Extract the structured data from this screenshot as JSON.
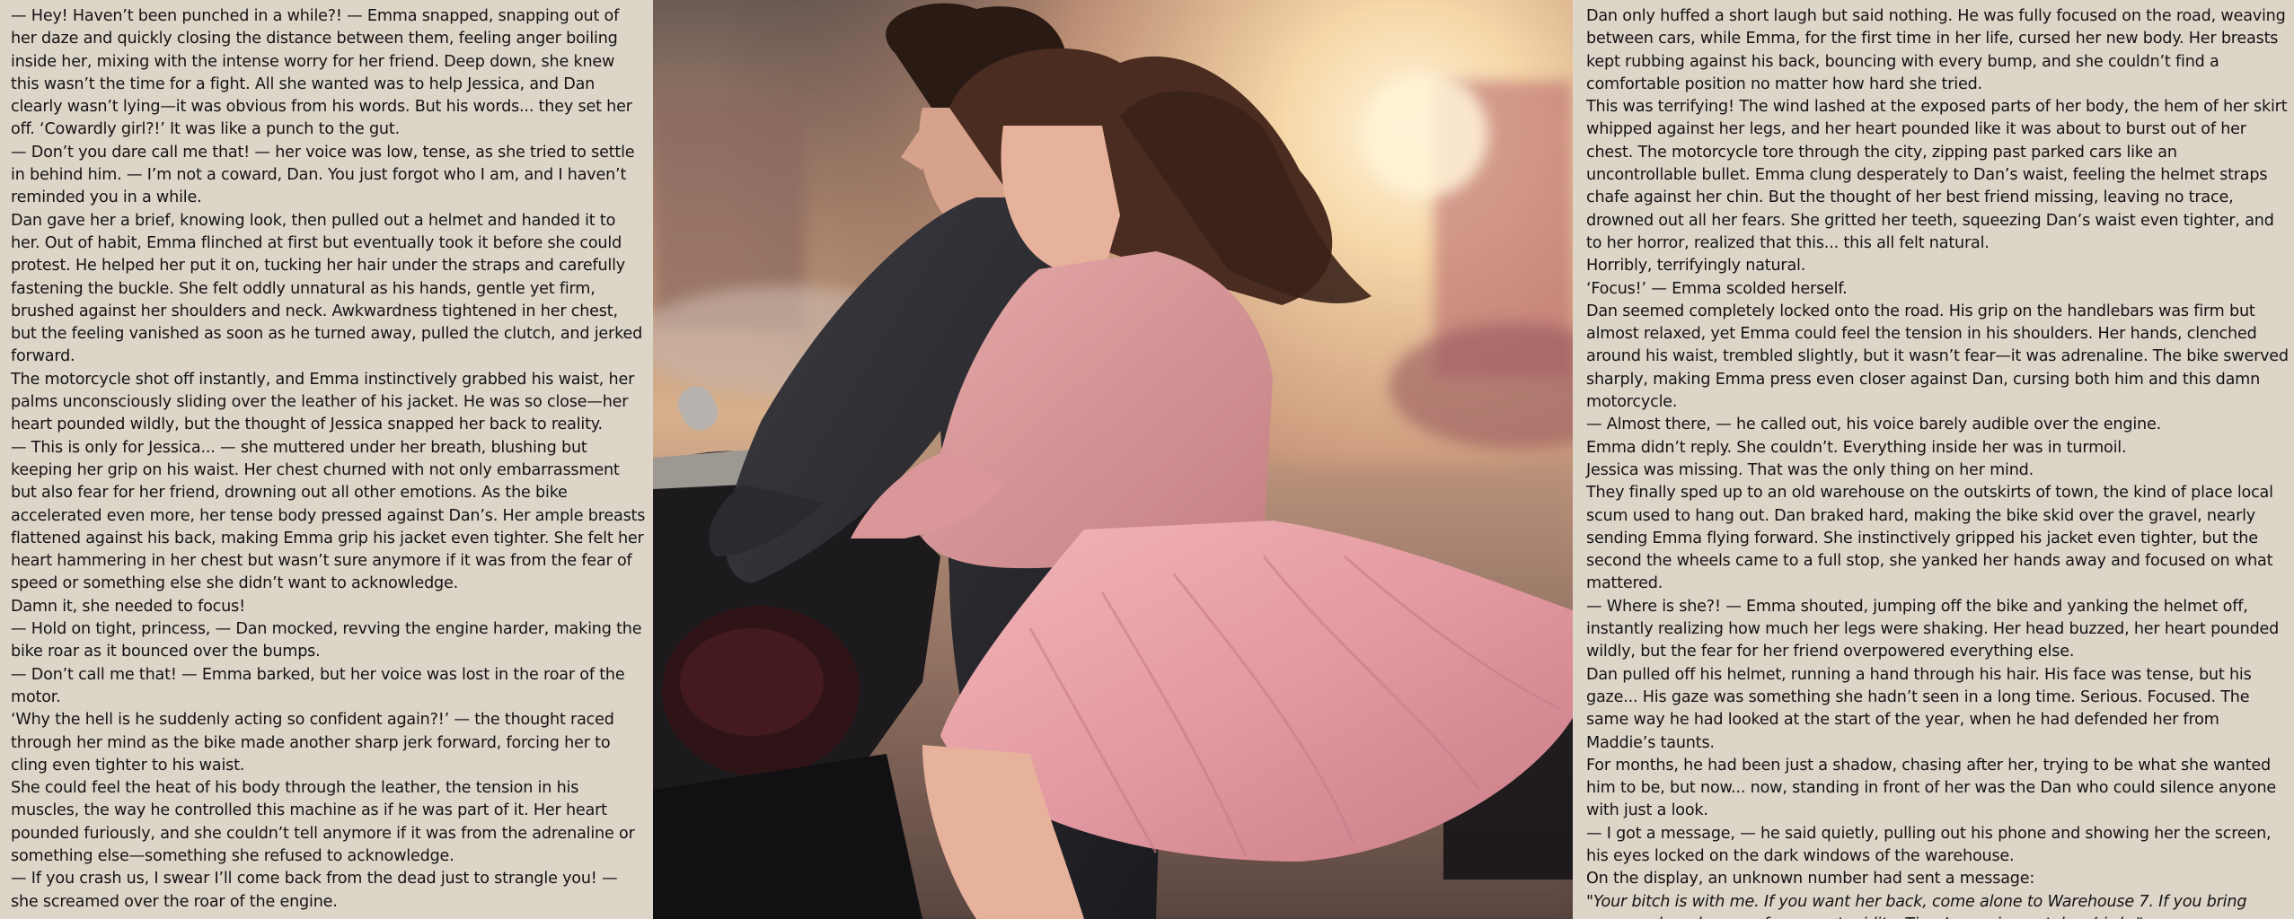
{
  "left_column": {
    "paragraphs": [
      "— Hey! Haven’t been punched in a while?! — Emma snapped, snapping out of her daze and quickly closing the distance between them, feeling anger boiling inside her, mixing with the intense worry for her friend. Deep down, she knew this wasn’t the time for a fight. All she wanted was to help Jessica, and Dan clearly wasn’t lying—it was obvious from his words. But his words... they set her off. ‘Cowardly girl?!’ It was like a punch to the gut.",
      "— Don’t you dare call me that! — her voice was low, tense, as she tried to settle in behind him. — I’m not a coward, Dan. You just forgot who I am, and I haven’t reminded you in a while.",
      "Dan gave her a brief, knowing look, then pulled out a helmet and handed it to her. Out of habit, Emma flinched at first but eventually took it before she could protest. He helped her put it on, tucking her hair under the straps and carefully fastening the buckle. She felt oddly unnatural as his hands, gentle yet firm, brushed against her shoulders and neck. Awkwardness tightened in her chest, but the feeling vanished as soon as he turned away, pulled the clutch, and jerked forward.",
      "The motorcycle shot off instantly, and Emma instinctively grabbed his waist, her palms unconsciously sliding over the leather of his jacket. He was so close—her heart pounded wildly, but the thought of Jessica snapped her back to reality.",
      "— This is only for Jessica... — she muttered under her breath, blushing but keeping her grip on his waist. Her chest churned with not only embarrassment but also fear for her friend, drowning out all other emotions. As the bike accelerated even more, her tense body pressed against Dan’s. Her ample breasts flattened against his back, making Emma grip his jacket even tighter. She felt her heart hammering in her chest but wasn’t sure anymore if it was from the fear of speed or something else she didn’t want to acknowledge.",
      "Damn it, she needed to focus!",
      "— Hold on tight, princess, — Dan mocked, revving the engine harder, making the bike roar as it bounced over the bumps.",
      "— Don’t call me that! — Emma barked, but her voice was lost in the roar of the motor.",
      "‘Why the hell is he suddenly acting so confident again?!’ — the thought raced through her mind as the bike made another sharp jerk forward, forcing her to cling even tighter to his waist.",
      "She could feel the heat of his body through the leather, the tension in his muscles, the way he controlled this machine as if he was part of it. Her heart pounded furiously, and she couldn’t tell anymore if it was from the adrenaline or something else—something she refused to acknowledge.",
      "— If you crash us, I swear I’ll come back from the dead just to strangle you! — she screamed over the roar of the engine."
    ]
  },
  "right_column": {
    "paragraphs": [
      "Dan only huffed a short laugh but said nothing. He was fully focused on the road, weaving between cars, while Emma, for the first time in her life, cursed her new body. Her breasts kept rubbing against his back, bouncing with every bump, and she couldn’t find a comfortable position no matter how hard she tried.",
      "This was terrifying! The wind lashed at the exposed parts of her body, the hem of her skirt whipped against her legs, and her heart pounded like it was about to burst out of her chest. The motorcycle tore through the city, zipping past parked cars like an uncontrollable bullet. Emma clung desperately to Dan’s waist, feeling the helmet straps chafe against her chin. But the thought of her best friend missing, leaving no trace, drowned out all her fears. She gritted her teeth, squeezing Dan’s waist even tighter, and to her horror, realized that this... this all felt natural.",
      "Horribly, terrifyingly natural.",
      "‘Focus!’ — Emma scolded herself.",
      "Dan seemed completely locked onto the road. His grip on the handlebars was firm but almost relaxed, yet Emma could feel the tension in his shoulders. Her hands, clenched around his waist, trembled slightly, but it wasn’t fear—it was adrenaline. The bike swerved sharply, making Emma press even closer against Dan, cursing both him and this damn motorcycle.",
      "— Almost there, — he called out, his voice barely audible over the engine.",
      "Emma didn’t reply. She couldn’t. Everything inside her was in turmoil.",
      "Jessica was missing. That was the only thing on her mind.",
      "They finally sped up to an old warehouse on the outskirts of town, the kind of place local scum used to hang out. Dan braked hard, making the bike skid over the gravel, nearly sending Emma flying forward. She instinctively gripped his jacket even tighter, but the second the wheels came to a full stop, she yanked her hands away and focused on what mattered.",
      "— Where is she?! — Emma shouted, jumping off the bike and yanking the helmet off, instantly realizing how much her legs were shaking. Her head buzzed, her heart pounded wildly, but the fear for her friend overpowered everything else.",
      "Dan pulled off his helmet, running a hand through his hair. His face was tense, but his gaze... His gaze was something she hadn’t seen in a long time. Serious. Focused. The same way he had looked at the start of the year, when he had defended her from Maddie’s taunts.",
      "For months, he had been just a shadow, chasing after her, trying to be what she wanted him to be, but now... now, standing in front of her was the Dan who could silence anyone with just a look.",
      "— I got a message, — he said quietly, pulling out his phone and showing her the screen, his eyes locked on the dark windows of the warehouse.",
      "On the display, an unknown number had sent a message:",
      "\"Your bitch is with me. If you want her back, come alone to Warehouse 7. If you bring anyone else, she pays for your stupidity. Time’s running out, lovebirds.\""
    ]
  },
  "illustration": {
    "subject": "couple-riding-motorcycle",
    "colors": {
      "sky_glow": "#f6d7a8",
      "sun": "#fff3d6",
      "jacket": "#2b2a2e",
      "sweater": "#d9979a",
      "skirt": "#e8a6ab",
      "hair_dark": "#2a1a14",
      "hair_brown": "#4a2c20",
      "skin": "#e7b29c",
      "bike_metal": "#1c1a1c",
      "chrome": "#b7b2ad"
    }
  }
}
